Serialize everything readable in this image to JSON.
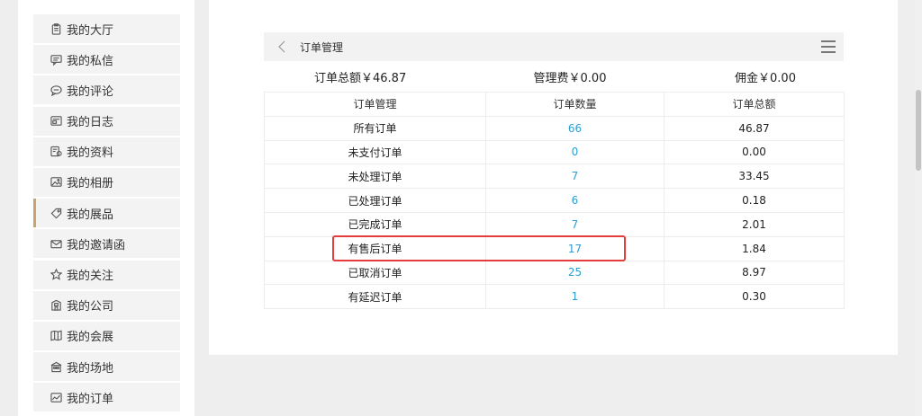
{
  "sidebar": {
    "items": [
      {
        "label": "我的大厅",
        "icon": "clipboard-icon"
      },
      {
        "label": "我的私信",
        "icon": "message-icon"
      },
      {
        "label": "我的评论",
        "icon": "comment-icon"
      },
      {
        "label": "我的日志",
        "icon": "log-icon"
      },
      {
        "label": "我的资料",
        "icon": "profile-icon"
      },
      {
        "label": "我的相册",
        "icon": "photo-icon"
      },
      {
        "label": "我的展品",
        "icon": "tag-icon"
      },
      {
        "label": "我的邀请函",
        "icon": "mail-icon"
      },
      {
        "label": "我的关注",
        "icon": "star-icon"
      },
      {
        "label": "我的公司",
        "icon": "building-icon"
      },
      {
        "label": "我的会展",
        "icon": "map-icon"
      },
      {
        "label": "我的场地",
        "icon": "venue-icon"
      },
      {
        "label": "我的订单",
        "icon": "chart-icon"
      }
    ],
    "active_index": 6
  },
  "panel": {
    "title": "订单管理"
  },
  "summary": {
    "total": "订单总额￥46.87",
    "fee": "管理费￥0.00",
    "commission": "佣金￥0.00"
  },
  "table": {
    "headers": [
      "订单管理",
      "订单数量",
      "订单总额"
    ],
    "rows": [
      {
        "name": "所有订单",
        "count": "66",
        "amount": "46.87"
      },
      {
        "name": "未支付订单",
        "count": "0",
        "amount": "0.00"
      },
      {
        "name": "未处理订单",
        "count": "7",
        "amount": "33.45"
      },
      {
        "name": "已处理订单",
        "count": "6",
        "amount": "0.18"
      },
      {
        "name": "已完成订单",
        "count": "7",
        "amount": "2.01"
      },
      {
        "name": "有售后订单",
        "count": "17",
        "amount": "1.84"
      },
      {
        "name": "已取消订单",
        "count": "25",
        "amount": "8.97"
      },
      {
        "name": "有延迟订单",
        "count": "1",
        "amount": "0.30"
      }
    ],
    "highlighted_row": 5
  },
  "colors": {
    "accent": "#c8a46a",
    "count_link": "#2a9fd6",
    "highlight": "#e23c3c"
  }
}
